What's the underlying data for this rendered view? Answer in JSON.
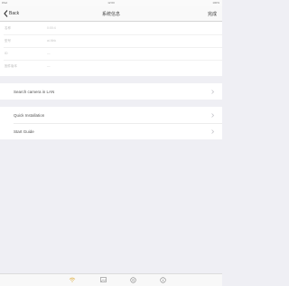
{
  "status": {
    "left": "iPad",
    "center": "12:00",
    "right": "100%"
  },
  "nav": {
    "back_label": "Back",
    "title": "系统信息",
    "done_label": "完成"
  },
  "info_rows": [
    {
      "label": "名称",
      "value": "0:00:4"
    },
    {
      "label": "型号",
      "value": "ai-Nhk"
    },
    {
      "label": "ID",
      "value": "—"
    },
    {
      "label": "固件版本",
      "value": "—"
    }
  ],
  "menu": {
    "group1": [
      {
        "label": "Search camera in LAN"
      }
    ],
    "group2": [
      {
        "label": "Quick Installation"
      },
      {
        "label": "Start Guide"
      }
    ]
  },
  "tabs": [
    "wifi-icon",
    "image-icon",
    "settings-icon",
    "info-icon"
  ],
  "colors": {
    "accent": "#3a3a3a",
    "background": "#efeff4"
  }
}
